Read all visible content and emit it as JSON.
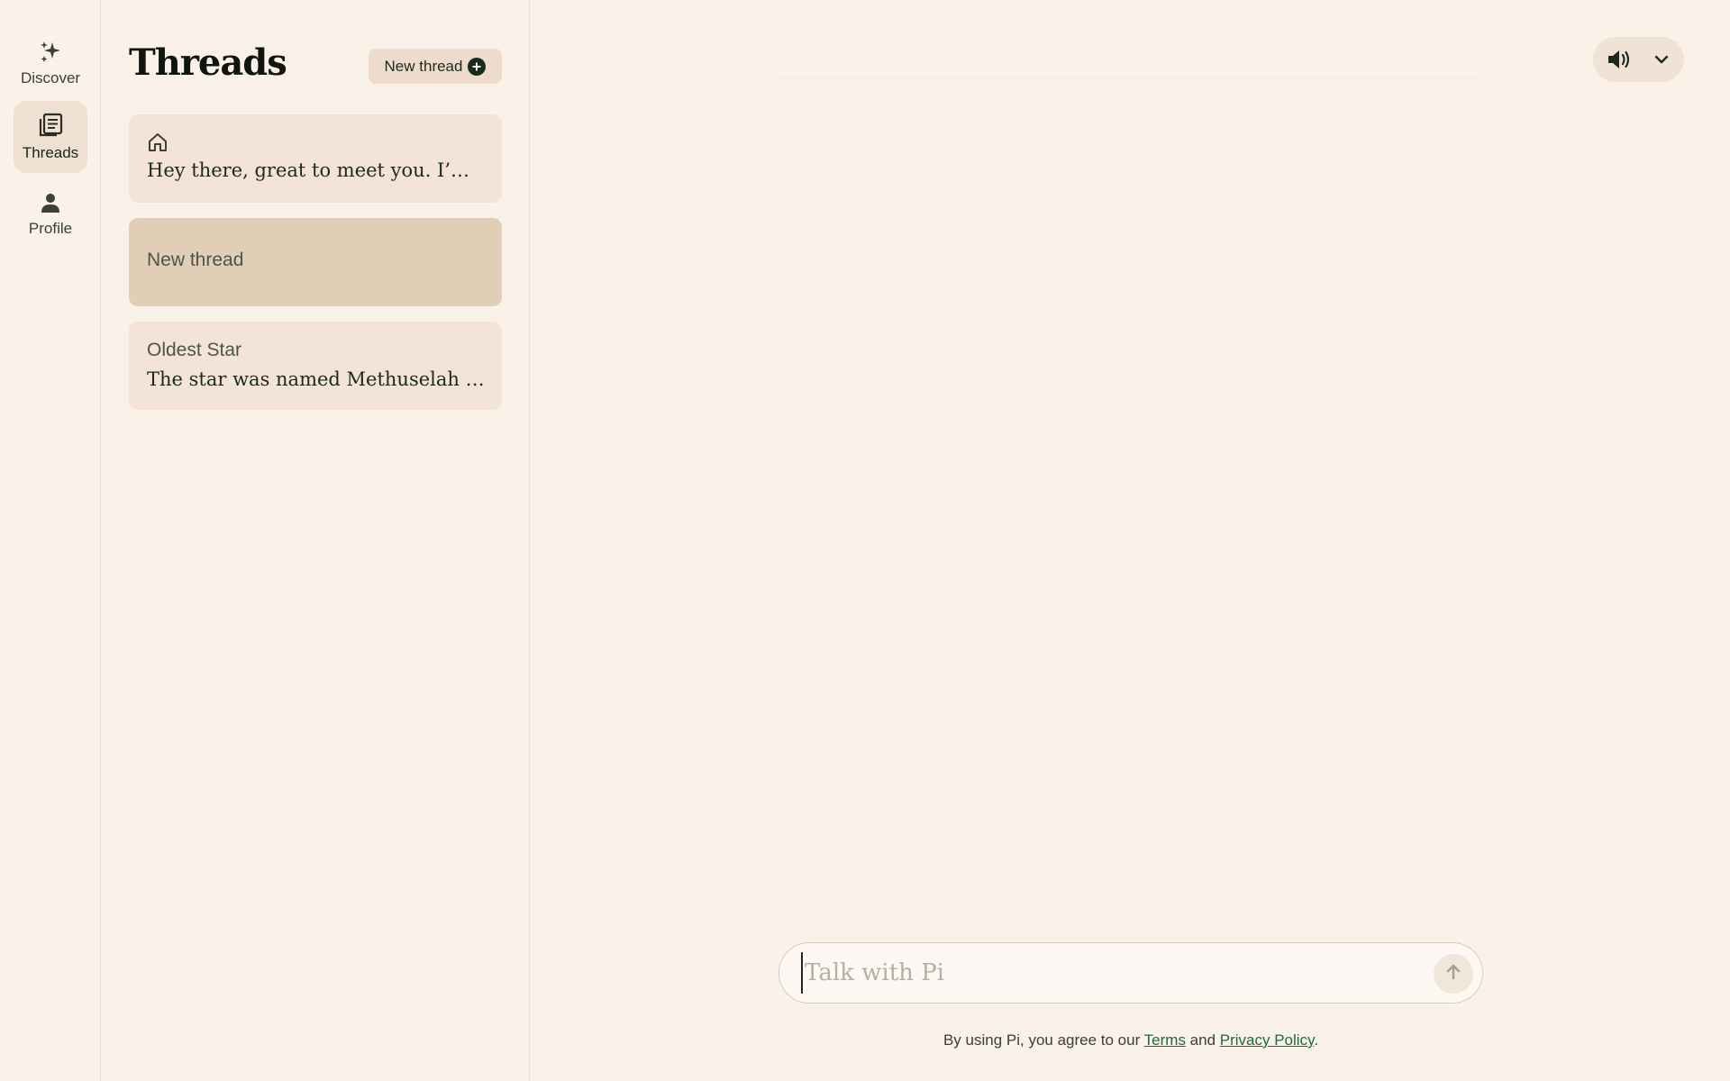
{
  "nav": {
    "items": [
      {
        "label": "Discover",
        "icon": "sparkle-icon",
        "active": false
      },
      {
        "label": "Threads",
        "icon": "threads-icon",
        "active": true
      },
      {
        "label": "Profile",
        "icon": "person-icon",
        "active": false
      }
    ]
  },
  "threads_panel": {
    "title": "Threads",
    "new_thread_label": "New thread",
    "cards": [
      {
        "icon": "home-icon",
        "subtitle": "",
        "preview": "Hey there, great to meet you. I’m Pi, your personal AI."
      },
      {
        "subtitle": "New thread",
        "preview": "",
        "selected": true
      },
      {
        "subtitle": "Oldest Star",
        "preview": "The star was named Methuselah after the oldest person in the Bible."
      }
    ]
  },
  "voice": {
    "speaker_icon": "speaker-icon",
    "dropdown_icon": "chevron-down-icon"
  },
  "composer": {
    "placeholder": "Talk with Pi",
    "value": ""
  },
  "legal": {
    "prefix": "By using Pi, you agree to our ",
    "terms": "Terms",
    "and": " and ",
    "privacy": "Privacy Policy",
    "suffix": "."
  },
  "colors": {
    "background": "#faf1e8",
    "accent": "#1f6a3e",
    "selected_card": "#e0cfb6"
  }
}
